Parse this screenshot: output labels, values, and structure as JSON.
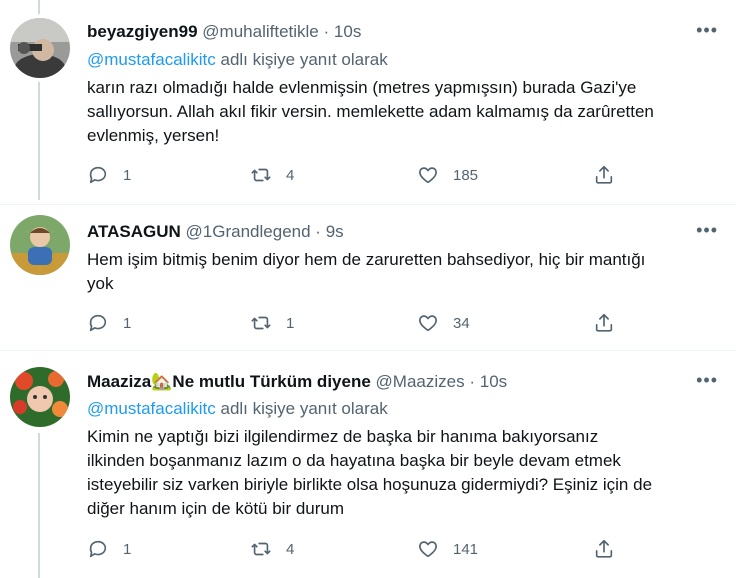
{
  "tweets": [
    {
      "name": "beyazgiyen99",
      "handle": "@muhaliftetikle",
      "time": "10s",
      "reply_mention": "@mustafacalikitc",
      "reply_suffix": "adlı kişiye yanıt olarak",
      "text_lines": [
        "karın razı olmadığı halde evlenmişsin (metres yapmışsın) burada Gazi'ye",
        "sallıyorsun. Allah akıl fikir versin. memlekette adam kalmamış da zarûretten",
        "evlenmiş, yersen!"
      ],
      "replies": "1",
      "retweets": "4",
      "likes": "185"
    },
    {
      "name": "ATASAGUN",
      "handle": "@1Grandlegend",
      "time": "9s",
      "text_lines": [
        "Hem işim bitmiş benim diyor hem de zaruretten bahsediyor, hiç bir mantığı",
        "yok"
      ],
      "replies": "1",
      "retweets": "1",
      "likes": "34"
    },
    {
      "name": "Maaziza",
      "name_emoji": "🏡",
      "name_suffix": "Ne mutlu Türküm diyene",
      "handle": "@Maazizes",
      "time": "10s",
      "reply_mention": "@mustafacalikitc",
      "reply_suffix": "adlı kişiye yanıt olarak",
      "text_lines": [
        "Kimin ne yaptığı bizi ilgilendirmez de  başka bir hanıma bakıyorsanız",
        "ilkinden boşanmanız lazım o da hayatına başka bir beyle devam etmek",
        "isteyebilir siz varken biriyle birlikte olsa hoşunuza gidermiydi? Eşiniz için de",
        "diğer hanım için de kötü bir durum"
      ],
      "replies": "1",
      "retweets": "4",
      "likes": "141"
    }
  ],
  "more_icon": "more-horizontal-icon",
  "colors": {
    "link": "#1d9bf0",
    "secondary": "#536471",
    "text": "#0f1419",
    "border": "#eff3f4"
  }
}
